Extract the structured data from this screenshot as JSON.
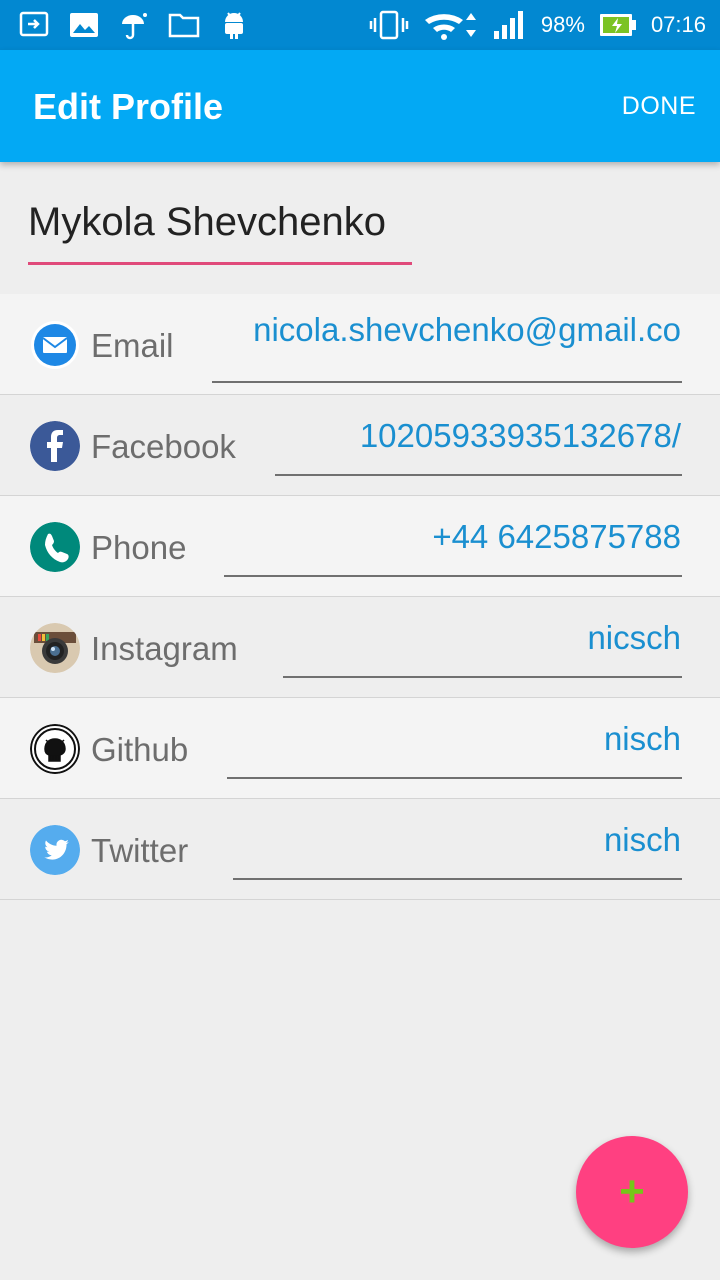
{
  "status_bar": {
    "battery": "98%",
    "time": "07:16"
  },
  "app_bar": {
    "title": "Edit Profile",
    "done_label": "DONE"
  },
  "profile": {
    "name": "Mykola Shevchenko"
  },
  "fields": [
    {
      "label": "Email",
      "value": "nicola.shevchenko@gmail.co",
      "icon": "email-icon"
    },
    {
      "label": "Facebook",
      "value": "10205933935132678/",
      "icon": "facebook-icon"
    },
    {
      "label": "Phone",
      "value": "+44 6425875788",
      "icon": "phone-icon"
    },
    {
      "label": "Instagram",
      "value": "nicsch",
      "icon": "instagram-icon"
    },
    {
      "label": "Github",
      "value": "nisch",
      "icon": "github-icon"
    },
    {
      "label": "Twitter",
      "value": "nisch",
      "icon": "twitter-icon"
    }
  ],
  "fab": {
    "label": "+",
    "color": "#ff4081"
  },
  "colors": {
    "app_bar": "#03a9f4",
    "status_bar": "#0288d1",
    "link": "#1a8fd0"
  }
}
